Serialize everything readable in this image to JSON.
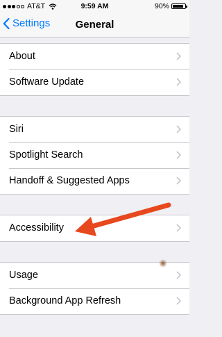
{
  "status_bar": {
    "carrier": "AT&T",
    "time": "9:59 AM",
    "battery": "90%",
    "battery_level": 0.9
  },
  "nav": {
    "back_label": "Settings",
    "title": "General"
  },
  "groups": [
    {
      "items": [
        {
          "label": "About"
        },
        {
          "label": "Software Update"
        }
      ]
    },
    {
      "items": [
        {
          "label": "Siri"
        },
        {
          "label": "Spotlight Search"
        },
        {
          "label": "Handoff & Suggested Apps"
        }
      ]
    },
    {
      "items": [
        {
          "label": "Accessibility"
        }
      ]
    },
    {
      "items": [
        {
          "label": "Usage"
        },
        {
          "label": "Background App Refresh"
        }
      ]
    }
  ],
  "colors": {
    "accent": "#007aff",
    "arrow": "#e8481d",
    "background": "#efeff4"
  }
}
